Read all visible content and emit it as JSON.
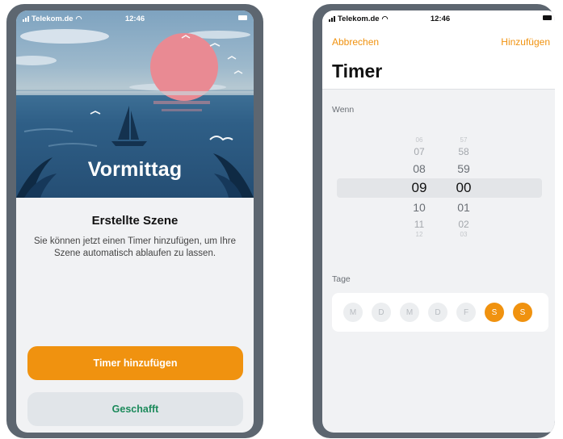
{
  "status_bar": {
    "carrier": "Telekom.de",
    "time": "12:46"
  },
  "scene_screen": {
    "hero_title": "Vormittag",
    "card_title": "Erstellte Szene",
    "card_description": "Sie können jetzt einen Timer hinzufügen, um Ihre Szene automatisch ablaufen zu lassen.",
    "primary_button": "Timer hinzufügen",
    "secondary_button": "Geschafft"
  },
  "timer_screen": {
    "cancel_label": "Abbrechen",
    "add_label": "Hinzufügen",
    "title": "Timer",
    "when_label": "Wenn",
    "hours": [
      "06",
      "07",
      "08",
      "09",
      "10",
      "11",
      "12"
    ],
    "minutes": [
      "57",
      "58",
      "59",
      "00",
      "01",
      "02",
      "03"
    ],
    "selected_hour": "09",
    "selected_minute": "00",
    "days_label": "Tage",
    "days": [
      {
        "label": "M",
        "selected": false
      },
      {
        "label": "D",
        "selected": false
      },
      {
        "label": "M",
        "selected": false
      },
      {
        "label": "D",
        "selected": false
      },
      {
        "label": "F",
        "selected": false
      },
      {
        "label": "S",
        "selected": true
      },
      {
        "label": "S",
        "selected": true
      }
    ]
  },
  "colors": {
    "accent": "#f0920f",
    "success_text": "#1c8a5b",
    "frame": "#5d6670"
  }
}
